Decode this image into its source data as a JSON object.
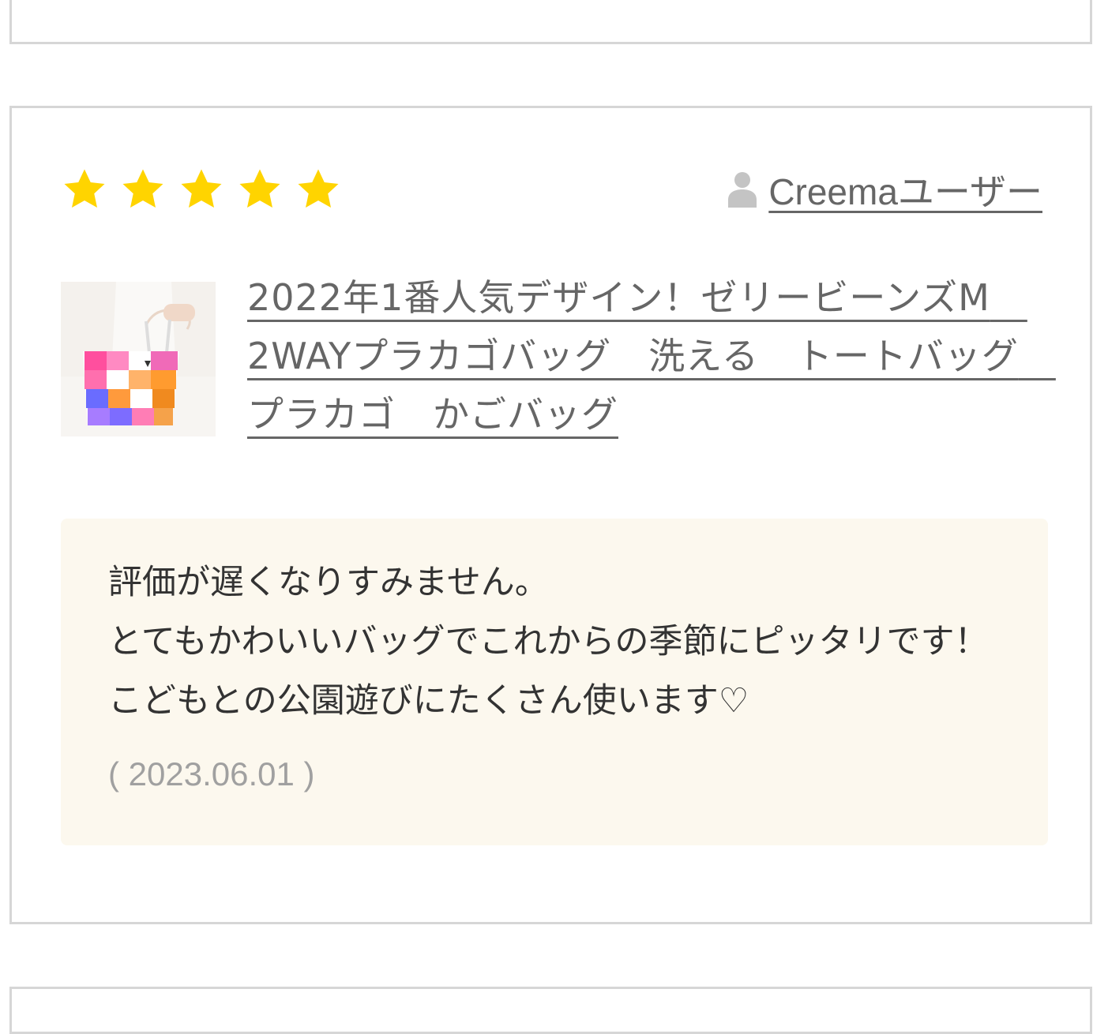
{
  "review": {
    "rating": 5,
    "rating_max": 5,
    "star_color": "#FFD400",
    "reviewer_name": "Creemaユーザー",
    "product_title": "2022年1番人気デザイン！ゼリービーンズM　2WAYプラカゴバッグ　洗える　トートバッグ　プラカゴ　かごバッグ",
    "comment": "評価が遅くなりすみません。\nとてもかわいいバッグでこれからの季節にピッタリです！こどもとの公園遊びにたくさん使います♡",
    "date": "( 2023.06.01 )"
  },
  "icons": {
    "star": "star-icon",
    "user": "user-icon"
  },
  "colors": {
    "card_border": "#d6d6d6",
    "review_bg": "#fcf8ee",
    "link_text": "#666666",
    "date_text": "#a0a0a0"
  }
}
